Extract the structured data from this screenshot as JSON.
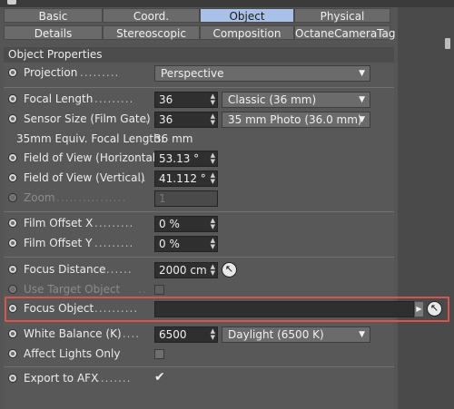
{
  "tabs_row1": [
    "Basic",
    "Coord.",
    "Object",
    "Physical"
  ],
  "tabs_row2": [
    "Details",
    "Stereoscopic",
    "Composition",
    "OctaneCameraTag"
  ],
  "active_tab": "Object",
  "section_title": "Object Properties",
  "properties": {
    "projection": {
      "label": "Projection",
      "value": "Perspective"
    },
    "focal_length": {
      "label": "Focal Length",
      "value": "36",
      "preset": "Classic (36 mm)"
    },
    "sensor_size": {
      "label": "Sensor Size (Film Gate)",
      "value": "36",
      "preset": "35 mm Photo (36.0 mm)"
    },
    "equiv_focal": {
      "label": "35mm Equiv. Focal Length:",
      "value": "36 mm"
    },
    "fov_h": {
      "label": "Field of View (Horizontal)",
      "value": "53.13 °"
    },
    "fov_v": {
      "label": "Field of View (Vertical)",
      "value": "41.112 °"
    },
    "zoom": {
      "label": "Zoom",
      "value": "1"
    },
    "film_offset_x": {
      "label": "Film Offset X",
      "value": "0 %"
    },
    "film_offset_y": {
      "label": "Film Offset Y",
      "value": "0 %"
    },
    "focus_distance": {
      "label": "Focus Distance",
      "value": "2000 cm"
    },
    "use_target_object": {
      "label": "Use Target Object",
      "checked": false
    },
    "focus_object": {
      "label": "Focus Object",
      "value": ""
    },
    "white_balance": {
      "label": "White Balance (K)",
      "value": "6500",
      "preset": "Daylight (6500 K)"
    },
    "affect_lights_only": {
      "label": "Affect Lights Only",
      "checked": false
    },
    "export_to_afx": {
      "label": "Export to AFX",
      "checked": true
    }
  },
  "colors": {
    "highlight": "#d9534f",
    "active_tab": "#a9c1e6"
  }
}
